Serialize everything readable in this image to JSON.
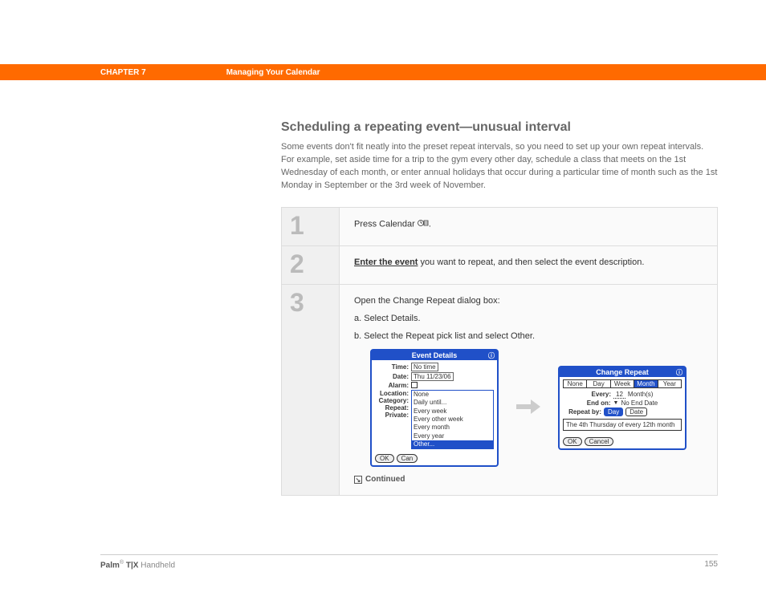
{
  "header": {
    "chapter": "CHAPTER 7",
    "title": "Managing Your Calendar"
  },
  "section": {
    "heading": "Scheduling a repeating event—unusual interval",
    "intro": "Some events don't fit neatly into the preset repeat intervals, so you need to set up your own repeat intervals. For example, set aside time for a trip to the gym every other day, schedule a class that meets on the 1st Wednesday of each month, or enter annual holidays that occur during a particular time of month such as the 1st Monday in September or the 3rd week of November."
  },
  "steps": {
    "s1": {
      "num": "1",
      "text_a": "Press Calendar ",
      "text_b": "."
    },
    "s2": {
      "num": "2",
      "link": "Enter the event",
      "text": " you want to repeat, and then select the event description."
    },
    "s3": {
      "num": "3",
      "intro": "Open the Change Repeat dialog box:",
      "a": "a.  Select Details.",
      "b": "b.  Select the Repeat pick list and select Other.",
      "continued": "Continued"
    }
  },
  "palm1": {
    "title": "Event Details",
    "time_label": "Time:",
    "time_val": "No time",
    "date_label": "Date:",
    "date_val": "Thu 11/23/06",
    "alarm_label": "Alarm:",
    "location_label": "Location:",
    "category_label": "Category:",
    "repeat_label": "Repeat:",
    "private_label": "Private:",
    "options": {
      "o0": "None",
      "o1": "Daily until...",
      "o2": "Every week",
      "o3": "Every other week",
      "o4": "Every month",
      "o5": "Every year",
      "o6": "Other..."
    },
    "ok": "OK",
    "cancel": "Can"
  },
  "palm2": {
    "title": "Change Repeat",
    "tabs": {
      "t0": "None",
      "t1": "Day",
      "t2": "Week",
      "t3": "Month",
      "t4": "Year"
    },
    "every_label": "Every:",
    "every_val": "12",
    "every_unit": "Month(s)",
    "end_label": "End on:",
    "end_val": "No End Date",
    "repeatby_label": "Repeat by:",
    "repeatby_day": "Day",
    "repeatby_date": "Date",
    "msg": "The 4th Thursday of every 12th month",
    "ok": "OK",
    "cancel": "Cancel"
  },
  "footer": {
    "brand_a": "Palm",
    "brand_b": " T|X",
    "brand_c": " Handheld",
    "page": "155"
  }
}
